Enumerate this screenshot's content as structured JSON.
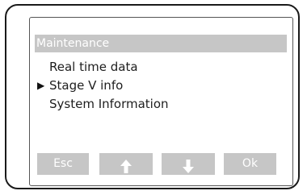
{
  "screen": {
    "title": "Maintenance"
  },
  "menu": {
    "items": [
      {
        "label": "Real time data",
        "selected": false
      },
      {
        "label": "Stage V info",
        "selected": true
      },
      {
        "label": "System Information",
        "selected": false
      }
    ],
    "selection_marker": "▶"
  },
  "buttons": {
    "esc_label": "Esc",
    "up_icon": "arrow-up-icon",
    "down_icon": "arrow-down-icon",
    "ok_label": "Ok"
  },
  "colors": {
    "title_bar_bg": "#c6c6c6",
    "button_bg": "#c6c6c6",
    "button_text": "#ffffff",
    "frame": "#1a1a1a"
  }
}
